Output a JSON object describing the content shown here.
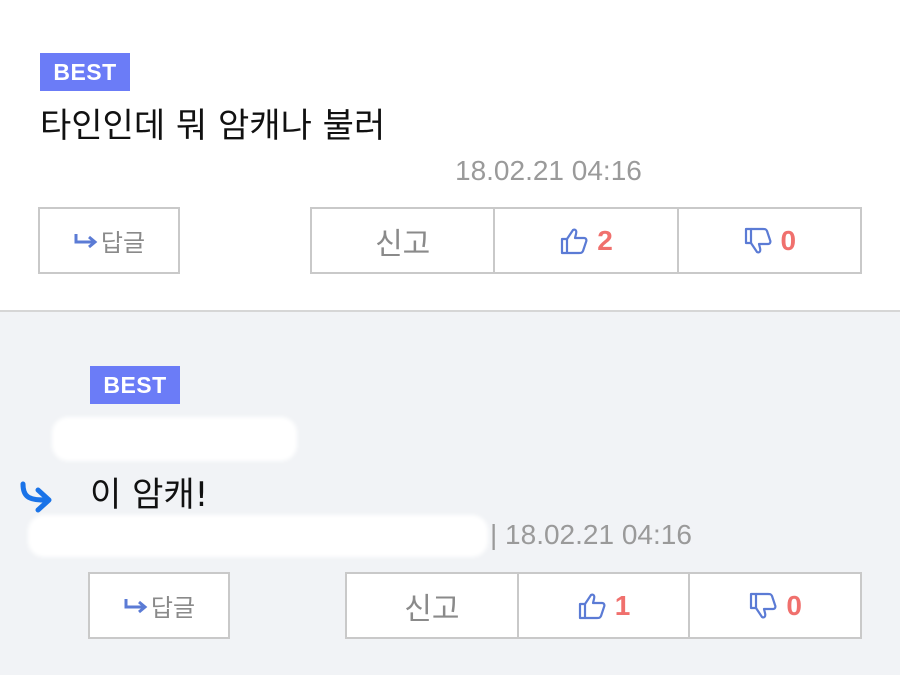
{
  "comments": [
    {
      "badge": "BEST",
      "text": "타인인데 뭐 암캐나 불러",
      "meta": "18.02.21 04:16",
      "reply_label": "답글",
      "report_label": "신고",
      "likes": "2",
      "dislikes": "0"
    },
    {
      "badge": "BEST",
      "text": "이 암캐!",
      "meta": "| 18.02.21 04:16",
      "reply_label": "답글",
      "report_label": "신고",
      "likes": "1",
      "dislikes": "0"
    }
  ],
  "colors": {
    "badge": "#6b7cf7",
    "count": "#f0706d",
    "icon_blue": "#5b7bd5",
    "reply_arrow": "#1a73e8"
  },
  "icons": [
    "reply-arrow-icon",
    "thumbs-up-icon",
    "thumbs-down-icon",
    "nested-reply-arrow-icon"
  ]
}
